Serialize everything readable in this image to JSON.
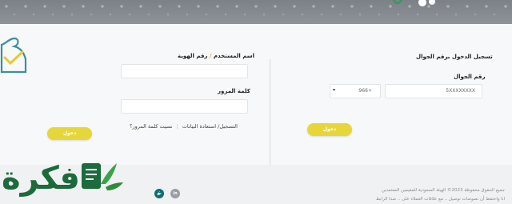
{
  "colors": {
    "accent": "#e6d63a",
    "label_accent": "#e4a300",
    "brand_green": "#1c6b3a",
    "twitter": "#0d6e72",
    "linkedin": "#9a9ea3"
  },
  "mobile_login": {
    "title": "تسجيل الدخول برقم الجوال",
    "phone_label": "رقم الجوال",
    "phone_value": "5XXXXXXXX",
    "country_code": "966+",
    "submit_label": "دخول"
  },
  "user_login": {
    "username_label": "اسم المستخدم",
    "separator": "/",
    "id_label": "رقم الهوية",
    "username_value": "",
    "password_label": "كلمة المرور",
    "password_value": "",
    "register_link": "التسجيل/ استعادة البيانات",
    "forgot_link": "نسيت كلمة المرور؟",
    "submit_label": "دخول"
  },
  "footer": {
    "copyright_line1": "جميع الحقوق محفوظة 2023© الهيئة السعودية للمقيمين المعتمدين",
    "copyright_line2": "انا واحتفظ أن نصوصات نوصيل .. مع علاقات العملاء على .. صدا الرابط",
    "social": [
      {
        "name": "twitter-icon",
        "glyph": "🐦"
      },
      {
        "name": "linkedin-icon",
        "glyph": "in"
      }
    ]
  },
  "watermark": {
    "text": "فكرة"
  }
}
